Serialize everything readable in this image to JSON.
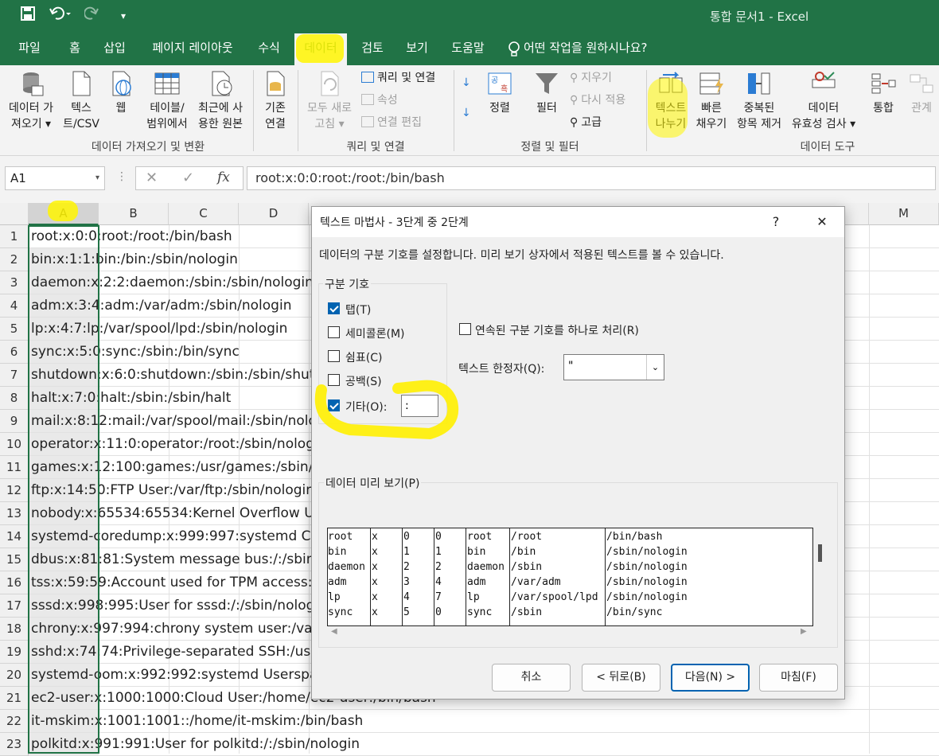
{
  "app": {
    "doc_title": "통합 문서1  -  Excel"
  },
  "qat": {
    "save": "💾",
    "undo": "↶",
    "redo": "↷",
    "more": "▾"
  },
  "menu": [
    {
      "label": "파일"
    },
    {
      "label": "홈"
    },
    {
      "label": "삽입"
    },
    {
      "label": "페이지 레이아웃"
    },
    {
      "label": "수식"
    },
    {
      "label": "데이터"
    },
    {
      "label": "검토"
    },
    {
      "label": "보기"
    },
    {
      "label": "도움말"
    },
    {
      "label": "어떤 작업을 원하시나요?"
    }
  ],
  "ribbon": {
    "get_data_l1": "데이터 가",
    "get_data_l2": "져오기 ▾",
    "text_csv_l1": "텍스",
    "text_csv_l2": "트/CSV",
    "web": "웹",
    "table_l1": "테이블/",
    "table_l2": "범위에서",
    "recent_l1": "최근에 사",
    "recent_l2": "용한 원본",
    "existing_l1": "기존",
    "existing_l2": "연결",
    "group_get": "데이터 가져오기 및 변환",
    "refresh_l1": "모두 새로",
    "refresh_l2": "고침 ▾",
    "queries": "쿼리 및 연결",
    "props": "속성",
    "edit_links": "연결 편집",
    "group_queries": "쿼리 및 연결",
    "sort_az": "공↓",
    "sort": "정렬",
    "filter": "필터",
    "clear": "지우기",
    "reapply": "다시 적용",
    "advanced": "고급",
    "group_sort": "정렬 및 필터",
    "text_to_cols_l1": "텍스트",
    "text_to_cols_l2": "나누기",
    "flash_l1": "빠른",
    "flash_l2": "채우기",
    "remove_dup_l1": "중복된",
    "remove_dup_l2": "항목 제거",
    "validation_l1": "데이터",
    "validation_l2": "유효성 검사 ▾",
    "consolidate": "통합",
    "relations": "관계",
    "group_tools": "데이터 도구"
  },
  "formula": {
    "namebox": "A1",
    "value": "root:x:0:0:root:/root:/bin/bash",
    "cancel": "✕",
    "enter": "✓",
    "fx": "fx"
  },
  "columns": [
    "A",
    "B",
    "C",
    "D",
    "M"
  ],
  "rows": [
    {
      "n": "1",
      "text": "root:x:0:0:root:/root:/bin/bash"
    },
    {
      "n": "2",
      "text": "bin:x:1:1:bin:/bin:/sbin/nologin"
    },
    {
      "n": "3",
      "text": "daemon:x:2:2:daemon:/sbin:/sbin/nologin"
    },
    {
      "n": "4",
      "text": "adm:x:3:4:adm:/var/adm:/sbin/nologin"
    },
    {
      "n": "5",
      "text": "lp:x:4:7:lp:/var/spool/lpd:/sbin/nologin"
    },
    {
      "n": "6",
      "text": "sync:x:5:0:sync:/sbin:/bin/sync"
    },
    {
      "n": "7",
      "text": "shutdown:x:6:0:shutdown:/sbin:/sbin/shutdo"
    },
    {
      "n": "8",
      "text": "halt:x:7:0:halt:/sbin:/sbin/halt"
    },
    {
      "n": "9",
      "text": "mail:x:8:12:mail:/var/spool/mail:/sbin/nologin"
    },
    {
      "n": "10",
      "text": "operator:x:11:0:operator:/root:/sbin/nologin"
    },
    {
      "n": "11",
      "text": "games:x:12:100:games:/usr/games:/sbin/nol"
    },
    {
      "n": "12",
      "text": "ftp:x:14:50:FTP User:/var/ftp:/sbin/nologin"
    },
    {
      "n": "13",
      "text": "nobody:x:65534:65534:Kernel Overflow Use"
    },
    {
      "n": "14",
      "text": "systemd-coredump:x:999:997:systemd Core"
    },
    {
      "n": "15",
      "text": "dbus:x:81:81:System message bus:/:/sbin/no"
    },
    {
      "n": "16",
      "text": "tss:x:59:59:Account used for TPM access:/d"
    },
    {
      "n": "17",
      "text": "sssd:x:998:995:User for sssd:/:/sbin/nologin"
    },
    {
      "n": "18",
      "text": "chrony:x:997:994:chrony system user:/var/lib"
    },
    {
      "n": "19",
      "text": "sshd:x:74:74:Privilege-separated SSH:/usr/sh"
    },
    {
      "n": "20",
      "text": "systemd-oom:x:992:992:systemd Userspace"
    },
    {
      "n": "21",
      "text": "ec2-user:x:1000:1000:Cloud User:/home/ec2-user:/bin/bash"
    },
    {
      "n": "22",
      "text": "it-mskim:x:1001:1001::/home/it-mskim:/bin/bash"
    },
    {
      "n": "23",
      "text": "polkitd:x:991:991:User for polkitd:/:/sbin/nologin"
    }
  ],
  "dialog": {
    "title": "텍스트 마법사 - 3단계 중 2단계",
    "help": "?",
    "close": "✕",
    "desc": "데이터의 구분 기호를 설정합니다. 미리 보기 상자에서 적용된 텍스트를 볼 수 있습니다.",
    "delims_title": "구분 기호",
    "tab": "탭(T)",
    "semicolon": "세미콜론(M)",
    "comma": "쉼표(C)",
    "space": "공백(S)",
    "other": "기타(O):",
    "other_value": ":",
    "consecutive": "연속된 구분 기호를 하나로 처리(R)",
    "qualifier_label": "텍스트 한정자(Q):",
    "qualifier_value": "\"",
    "preview_title": "데이터 미리 보기(P)",
    "preview": [
      [
        "root",
        "x",
        "0",
        "0",
        "root",
        "/root",
        "/bin/bash"
      ],
      [
        "bin",
        "x",
        "1",
        "1",
        "bin",
        "/bin",
        "/sbin/nologin"
      ],
      [
        "daemon",
        "x",
        "2",
        "2",
        "daemon",
        "/sbin",
        "/sbin/nologin"
      ],
      [
        "adm",
        "x",
        "3",
        "4",
        "adm",
        "/var/adm",
        "/sbin/nologin"
      ],
      [
        "lp",
        "x",
        "4",
        "7",
        "lp",
        "/var/spool/lpd",
        "/sbin/nologin"
      ],
      [
        "sync",
        "x",
        "5",
        "0",
        "sync",
        "/sbin",
        "/bin/sync"
      ]
    ],
    "cancel": "취소",
    "back": "< 뒤로(B)",
    "next": "다음(N) >",
    "finish": "마침(F)"
  }
}
